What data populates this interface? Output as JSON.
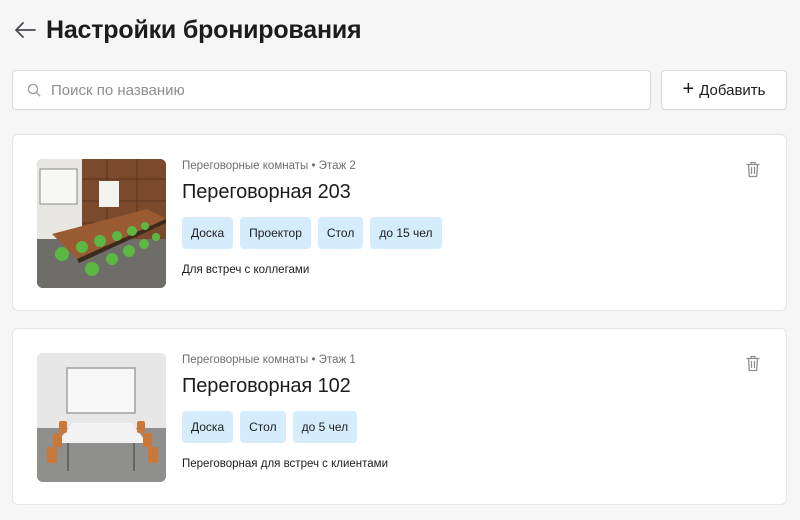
{
  "header": {
    "title": "Настройки бронирования",
    "back_icon": "arrow-left-icon"
  },
  "search": {
    "placeholder": "Поиск по названию",
    "value": "",
    "icon": "search-icon"
  },
  "toolbar": {
    "add_label": "Добавить",
    "add_icon": "plus-icon"
  },
  "colors": {
    "tag_bg": "#d4ecfb",
    "background": "#f6f6f7",
    "card_bg": "#ffffff"
  },
  "rooms": [
    {
      "meta": "Переговорные комнаты • Этаж 2",
      "name": "Переговорная 203",
      "tags": [
        "Доска",
        "Проектор",
        "Стол",
        "до 15 чел"
      ],
      "description": "Для встреч с коллегами",
      "delete_icon": "trash-icon"
    },
    {
      "meta": "Переговорные комнаты • Этаж 1",
      "name": "Переговорная 102",
      "tags": [
        "Доска",
        "Стол",
        "до 5 чел"
      ],
      "description": "Переговорная для встреч с клиентами",
      "delete_icon": "trash-icon"
    }
  ]
}
